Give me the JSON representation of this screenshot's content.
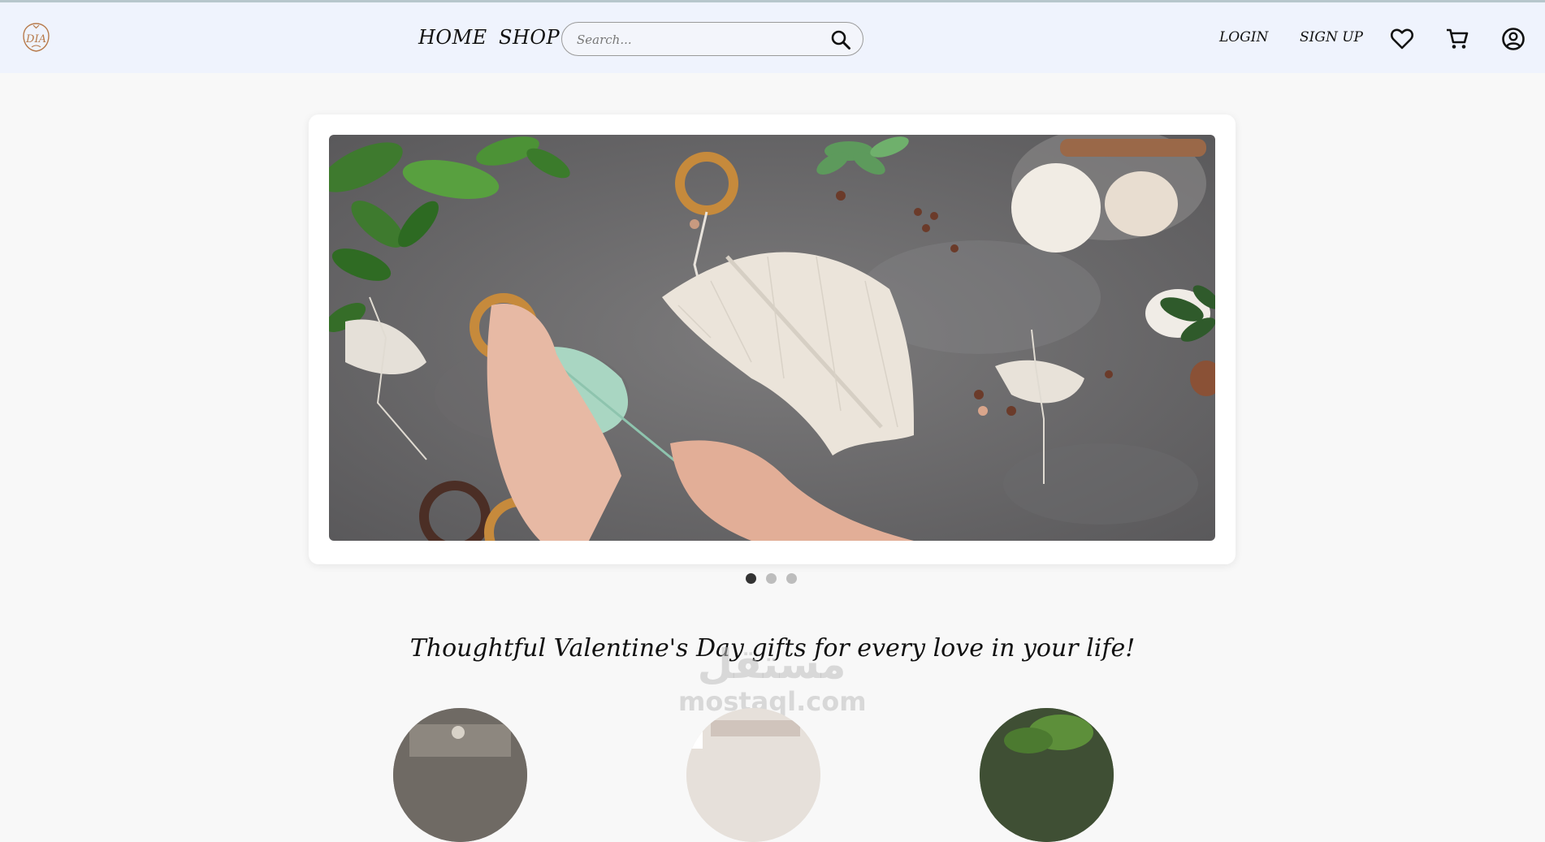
{
  "navbar": {
    "logo_icon": "dia-logo-icon",
    "home_label": "HOME",
    "shop_label": "SHOP",
    "search": {
      "placeholder": "Search...",
      "value": "",
      "icon": "search-icon"
    },
    "login_label": "LOGIN",
    "signup_label": "SIGN UP",
    "icons": [
      "heart-icon",
      "cart-icon",
      "account-icon"
    ]
  },
  "carousel": {
    "slide_count": 3,
    "active_slide": 1,
    "image_description_icon": "macrame-feather-image"
  },
  "section": {
    "title": "Thoughtful Valentine's Day gifts for every love in your life!"
  },
  "watermark": {
    "arabic": "مستقل",
    "latin": "mostaql.com"
  },
  "colors": {
    "navbar_bg": "#eff3fd",
    "page_bg": "#f8f8f8",
    "logo_accent": "#b77a4b",
    "dot_active": "#333333",
    "dot_inactive": "#bdbdbd"
  }
}
